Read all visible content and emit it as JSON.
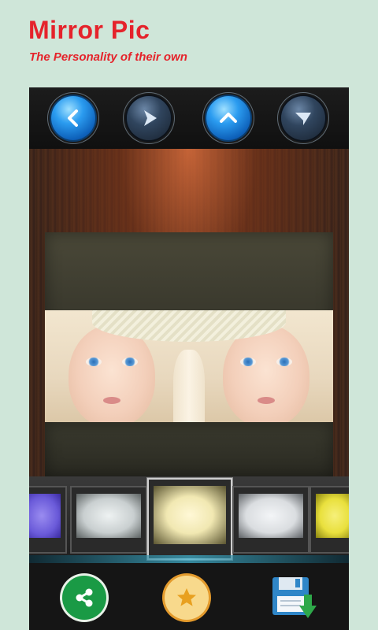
{
  "header": {
    "title": "Mirror Pic",
    "subtitle": "The Personality of their own"
  },
  "nav": {
    "buttons": [
      {
        "name": "back-button",
        "icon": "chevron-left-icon",
        "style": "blue"
      },
      {
        "name": "next-button",
        "icon": "play-right-icon",
        "style": "dark"
      },
      {
        "name": "mirror-up-button",
        "icon": "chevron-up-icon",
        "style": "blue"
      },
      {
        "name": "mirror-down-button",
        "icon": "chevron-down-icon",
        "style": "dark"
      }
    ]
  },
  "frames": {
    "thumbnails": [
      {
        "name": "frame-purple",
        "color": "#6a5ad9",
        "selected": false
      },
      {
        "name": "frame-grey",
        "color": "#c9cfd0",
        "selected": false
      },
      {
        "name": "frame-cream",
        "color": "#f1e8b2",
        "selected": true
      },
      {
        "name": "frame-silver",
        "color": "#dadde0",
        "selected": false
      },
      {
        "name": "frame-yellow",
        "color": "#e9e03d",
        "selected": false
      }
    ]
  },
  "actions": {
    "share_icon": "share-icon",
    "favorite_icon": "star-icon",
    "save_icon": "floppy-save-icon",
    "colors": {
      "share": "#1a9a45",
      "star": "#e8a020",
      "save": "#2f86c8"
    }
  },
  "colors": {
    "background": "#cfe6d9",
    "title": "#e5232b",
    "accent_blue": "#2b9cf0"
  }
}
